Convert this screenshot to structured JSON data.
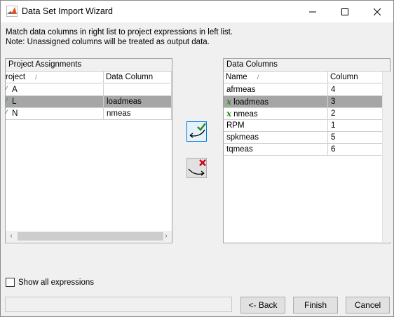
{
  "window": {
    "title": "Data Set Import Wizard",
    "app_icon": "matlab-icon",
    "controls": [
      "minimize-icon",
      "maximize-icon",
      "close-icon"
    ]
  },
  "instructions": {
    "line1": "Match data columns in right list to project expressions in left list.",
    "line2": "Note: Unassigned columns will be treated as output data."
  },
  "left_panel": {
    "title": "Project Assignments",
    "columns": [
      "roject",
      "Data Column"
    ],
    "rows": [
      {
        "expression": "A",
        "data_column": "",
        "selected": false
      },
      {
        "expression": "L",
        "data_column": "loadmeas",
        "selected": true
      },
      {
        "expression": "N",
        "data_column": "nmeas",
        "selected": false
      }
    ]
  },
  "right_panel": {
    "title": "Data Columns",
    "columns": [
      "Name",
      "Column"
    ],
    "rows": [
      {
        "name": "afrmeas",
        "column": "4",
        "marker": "",
        "selected": false
      },
      {
        "name": "loadmeas",
        "column": "3",
        "marker": "x",
        "selected": true
      },
      {
        "name": "nmeas",
        "column": "2",
        "marker": "x",
        "selected": false
      },
      {
        "name": "RPM",
        "column": "1",
        "marker": "",
        "selected": false
      },
      {
        "name": "spkmeas",
        "column": "5",
        "marker": "",
        "selected": false
      },
      {
        "name": "tqmeas",
        "column": "6",
        "marker": "",
        "selected": false
      }
    ]
  },
  "middle_buttons": {
    "assign_icon": "assign-check-icon",
    "unassign_icon": "unassign-x-icon"
  },
  "options": {
    "show_all_label": "Show all expressions",
    "show_all_checked": false
  },
  "footer": {
    "back_label": "<- Back",
    "finish_label": "Finish",
    "cancel_label": "Cancel"
  },
  "colors": {
    "selected_row": "#a6a6a6",
    "check_green": "#2e8b22",
    "remove_red": "#d0021b",
    "focus_blue": "#0078d7"
  }
}
